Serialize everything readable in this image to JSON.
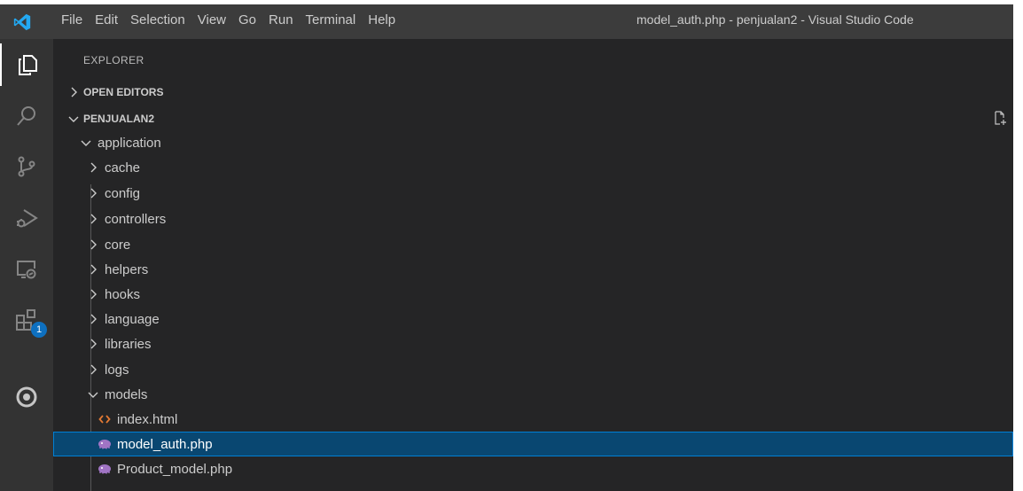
{
  "titlebar": {
    "menu": [
      "File",
      "Edit",
      "Selection",
      "View",
      "Go",
      "Run",
      "Terminal",
      "Help"
    ],
    "window_title": "model_auth.php - penjualan2 - Visual Studio Code"
  },
  "activity": {
    "items": [
      "files-icon",
      "search-icon",
      "source-control-icon",
      "run-debug-icon",
      "remote-explorer-icon",
      "extensions-icon",
      "target-icon"
    ],
    "extensions_badge": "1"
  },
  "explorer": {
    "title": "EXPLORER",
    "open_editors": "OPEN EDITORS",
    "project": "PENJUALAN2",
    "tree": [
      {
        "label": "application",
        "expanded": true
      },
      {
        "label": "cache"
      },
      {
        "label": "config"
      },
      {
        "label": "controllers"
      },
      {
        "label": "core"
      },
      {
        "label": "helpers"
      },
      {
        "label": "hooks"
      },
      {
        "label": "language"
      },
      {
        "label": "libraries"
      },
      {
        "label": "logs"
      },
      {
        "label": "models",
        "expanded": true
      },
      {
        "label": "index.html",
        "type": "html-file"
      },
      {
        "label": "model_auth.php",
        "type": "php-file",
        "selected": true
      },
      {
        "label": "Product_model.php",
        "type": "php-file"
      }
    ]
  },
  "colors": {
    "titlebar_bg": "#3c3c3c",
    "activity_bg": "#333333",
    "sidebar_bg": "#252526",
    "selection_bg": "#094771",
    "selection_border": "#007fd4",
    "vscode_blue": "#23a9f2",
    "html_icon": "#e37933",
    "php_icon": "#a074c4"
  }
}
